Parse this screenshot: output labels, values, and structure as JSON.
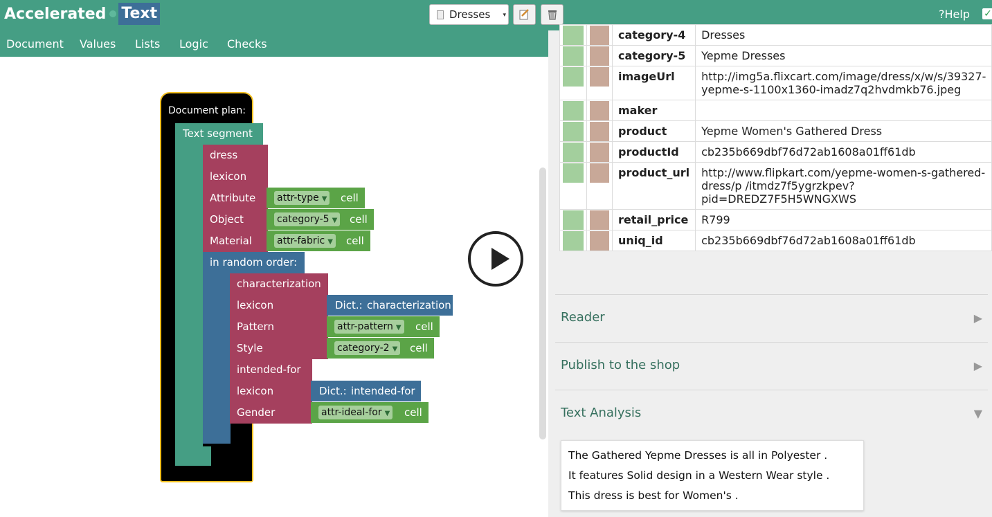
{
  "header": {
    "logo_part1": "Accelerated",
    "logo_part2": "Text",
    "document_select": "Dresses",
    "help_label": "?Help",
    "edit_icon": "edit-icon",
    "trash_icon": "trash-icon",
    "check_icon": "check-icon"
  },
  "toolbar": {
    "items": [
      "Document",
      "Values",
      "Lists",
      "Logic",
      "Checks"
    ]
  },
  "blocks": {
    "document_plan": "Document plan:",
    "text_segment": "Text segment",
    "dress": {
      "name": "dress",
      "lexicon": "lexicon",
      "attribute_label": "Attribute",
      "attribute_value": "attr-type",
      "object_label": "Object",
      "object_value": "category-5",
      "material_label": "Material",
      "material_value": "attr-fabric",
      "cell": "cell"
    },
    "random_order": "in random order:",
    "characterization": {
      "name": "characterization",
      "lexicon": "lexicon",
      "dict_prefix": "Dict.:",
      "dict_value": "characterization",
      "pattern_label": "Pattern",
      "pattern_value": "attr-pattern",
      "style_label": "Style",
      "style_value": "category-2",
      "cell": "cell"
    },
    "intended_for": {
      "name": "intended-for",
      "lexicon": "lexicon",
      "dict_prefix": "Dict.:",
      "dict_value": "intended-for",
      "gender_label": "Gender",
      "gender_value": "attr-ideal-for",
      "cell": "cell"
    }
  },
  "data_table": [
    {
      "key": "category-4",
      "value": "Dresses"
    },
    {
      "key": "category-5",
      "value": "Yepme Dresses"
    },
    {
      "key": "imageUrl",
      "value": "http://img5a.flixcart.com/image/dress/x/w/s/39327-yepme-s-1100x1360-imadz7q2hvdmkb76.jpeg"
    },
    {
      "key": "maker",
      "value": ""
    },
    {
      "key": "product",
      "value": "Yepme Women's Gathered Dress"
    },
    {
      "key": "productId",
      "value": "cb235b669dbf76d72ab1608a01ff61db"
    },
    {
      "key": "product_url",
      "value": "http://www.flipkart.com/yepme-women-s-gathered-dress/p /itmdz7f5ygrzkpev?pid=DREDZ7F5H5WNGXWS"
    },
    {
      "key": "retail_price",
      "value": "R799"
    },
    {
      "key": "uniq_id",
      "value": "cb235b669dbf76d72ab1608a01ff61db"
    }
  ],
  "sections": {
    "reader": "Reader",
    "publish": "Publish to the shop",
    "analysis": "Text Analysis",
    "collapsed_icon": "▶",
    "expanded_icon": "▼"
  },
  "text_analysis": [
    "The Gathered Yepme Dresses is all in Polyester .",
    "It features Solid design in a Western Wear style .",
    "This dress is best for Women's ."
  ],
  "colors": {
    "header": "#459e84",
    "logo_text_bg": "#3d6f98",
    "block_teal": "#459e84",
    "block_red": "#a5405e",
    "block_blue": "#3d6f98",
    "block_green": "#5ba447",
    "document_border": "#f3c020"
  }
}
